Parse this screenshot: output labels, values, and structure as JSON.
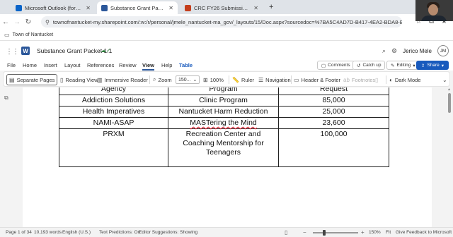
{
  "browser": {
    "tabs": [
      {
        "label": "Microsoft Outlook (formerly H...",
        "color": "#0a64c8"
      },
      {
        "label": "Substance Grant Packet 1.1.do...",
        "color": "#2b579a"
      },
      {
        "label": "CRC FY26 Submission Packet 1...",
        "color": "#c43e1c"
      }
    ],
    "new_tab": "+",
    "url": "townofnantucket-my.sharepoint.com/:w:/r/personal/jmele_nantucket-ma_gov/_layouts/15/Doc.aspx?sourcedoc=%7BA5C4AD7D-B417-4EA2-BDA8-BF...",
    "bookmark": "Town of Nantucket"
  },
  "word": {
    "doc_title": "Substance Grant Packet 1.1",
    "user_name": "Jerico Mele",
    "user_initials": "JM",
    "ribbon_tabs": [
      "File",
      "Home",
      "Insert",
      "Layout",
      "References",
      "Review",
      "View",
      "Help",
      "Table"
    ],
    "active_tab": "View",
    "comments_label": "Comments",
    "catchup_label": "Catch up",
    "editing_label": "Editing",
    "share_label": "Share"
  },
  "toolbar": {
    "separate_pages": "Separate Pages",
    "reading_view": "Reading View",
    "immersive_reader": "Immersive Reader",
    "zoom_label": "Zoom",
    "zoom_value": "150...",
    "zoom_100": "100%",
    "ruler": "Ruler",
    "navigation": "Navigation",
    "header_footer": "Header & Footer",
    "footnotes": "Footnotes",
    "dark_mode": "Dark Mode"
  },
  "document": {
    "headers": [
      "Agency",
      "Program",
      "Request"
    ],
    "rows": [
      [
        "Addiction Solutions",
        "Clinic Program",
        "85,000"
      ],
      [
        "Health Imperatives",
        "Nantucket Harm Reduction",
        "25,000"
      ],
      [
        "NAMI-ASAP",
        "MASTering the Mind",
        "23,600"
      ],
      [
        "PRXM",
        "Recreation Center and Coaching Mentorship for Teenagers",
        "100,000"
      ]
    ]
  },
  "status": {
    "page": "Page 1 of 34",
    "words": "10,193 words",
    "language": "English (U.S.)",
    "text_predictions": "Text Predictions: On",
    "editor_suggestions": "Editor Suggestions: Showing",
    "zoom_pct": "150%",
    "fit": "Fit",
    "feedback": "Give Feedback to Microsoft"
  }
}
